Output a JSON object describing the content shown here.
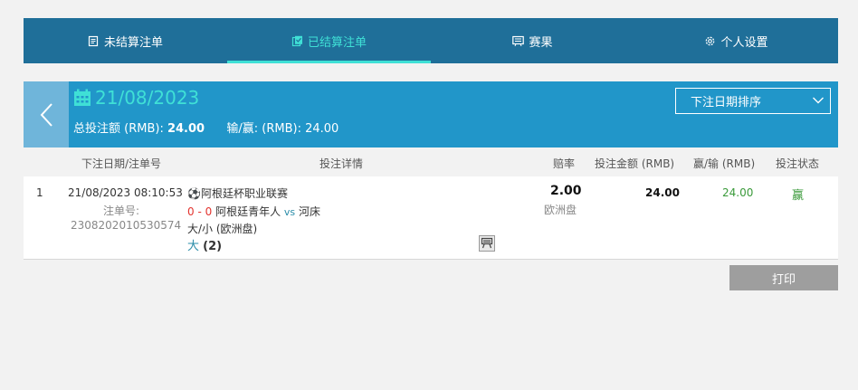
{
  "tabs": [
    {
      "label": "未结算注单",
      "icon": "document-list-icon",
      "active": false
    },
    {
      "label": "已结算注单",
      "icon": "document-check-icon",
      "active": true
    },
    {
      "label": "赛果",
      "icon": "scoreboard-icon",
      "active": false
    },
    {
      "label": "个人设置",
      "icon": "gear-icon",
      "active": false
    }
  ],
  "header": {
    "date": "21/08/2023",
    "total_label": "总投注额 (RMB):",
    "total_value": "24.00",
    "winloss_label": "输/赢: (RMB):",
    "winloss_value": "24.00",
    "sort_label": "下注日期排序"
  },
  "columns": {
    "date_no": "下注日期/注单号",
    "detail": "投注详情",
    "odds": "赔率",
    "stake": "投注金额 (RMB)",
    "winloss": "赢/输 (RMB)",
    "status": "投注状态"
  },
  "bet": {
    "index": "1",
    "datetime": "21/08/2023 08:10:53",
    "bet_no_label": "注单号:",
    "bet_no": "2308202010530574",
    "league": "阿根廷杯职业联赛",
    "score": "0 - 0",
    "home": "阿根廷青年人",
    "vs": "vs",
    "away": "河床",
    "market": "大/小 (欧洲盘)",
    "selection": "大",
    "line": "(2)",
    "odds": "2.00",
    "odds_type": "欧洲盘",
    "stake": "24.00",
    "winloss": "24.00",
    "status": "赢"
  },
  "print_label": "打印",
  "colors": {
    "tabbar": "#1f6f99",
    "accent": "#3fe0d6",
    "datebar": "#2196c9",
    "back": "#6fb5da",
    "win": "#3a9a3a",
    "score": "#e3342f"
  }
}
